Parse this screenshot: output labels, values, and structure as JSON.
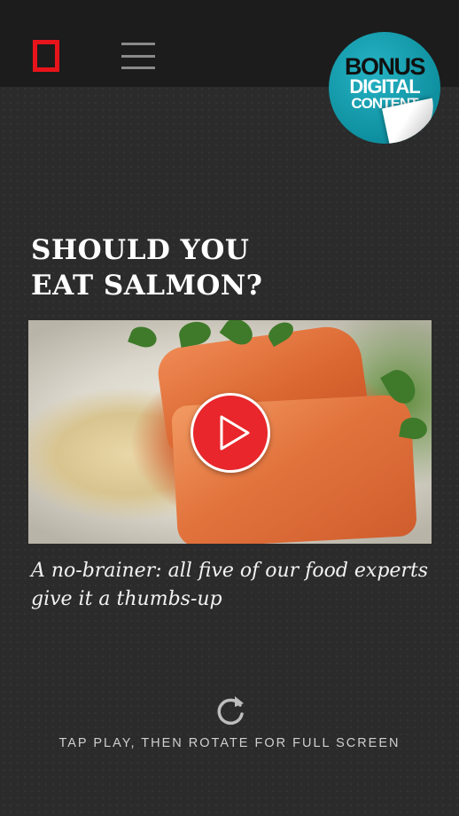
{
  "header": {
    "logo_icon": "yellow-border-rectangle-icon",
    "menu_icon": "hamburger-menu-icon",
    "badge": {
      "line1": "BONUS",
      "line2": "DIGITAL",
      "line3": "CONTENT",
      "color": "#16a2b3"
    }
  },
  "article": {
    "title_line1": "SHOULD YOU",
    "title_line2": "EAT SALMON?",
    "video": {
      "play_icon": "play-icon",
      "play_color": "#e8262c"
    },
    "caption": "A no-brainer: all five of our food experts give it a thumbs-up"
  },
  "footer": {
    "rotate_icon": "rotate-icon",
    "hint": "TAP PLAY, THEN ROTATE FOR FULL SCREEN"
  },
  "colors": {
    "background": "#2b2b2b",
    "topbar": "#1c1c1c",
    "logo_accent": "#e8141b"
  }
}
